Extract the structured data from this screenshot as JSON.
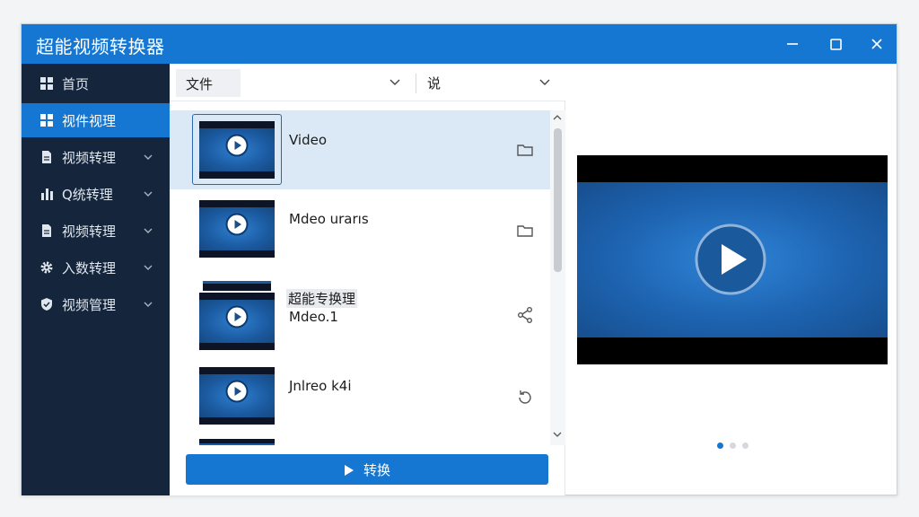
{
  "window": {
    "title": "超能视频转换器",
    "controls": [
      "minimize-icon",
      "maximize-icon",
      "close-icon"
    ]
  },
  "sidebar": {
    "items": [
      {
        "label": "首页",
        "icon": "grid-icon",
        "active": false,
        "expandable": false
      },
      {
        "label": "视件视理",
        "icon": "dashboard-icon",
        "active": true,
        "expandable": false
      },
      {
        "label": "视频转理",
        "icon": "document-icon",
        "active": false,
        "expandable": true
      },
      {
        "label": "Q统转理",
        "icon": "bar-chart-icon",
        "active": false,
        "expandable": true
      },
      {
        "label": "视频转理",
        "icon": "document-icon",
        "active": false,
        "expandable": true
      },
      {
        "label": "入数转理",
        "icon": "gear-icon",
        "active": false,
        "expandable": true
      },
      {
        "label": "视频管理",
        "icon": "shield-icon",
        "active": false,
        "expandable": true
      }
    ]
  },
  "toolbar": {
    "file_label": "文件",
    "sort_label": "说"
  },
  "files": [
    {
      "title": "Video",
      "subtitle": "",
      "action_icon": "folder-icon",
      "selected": true
    },
    {
      "title": "Mdeo urarıs",
      "subtitle": "",
      "action_icon": "folder-icon",
      "selected": false
    },
    {
      "title": "Mdeo.1",
      "subtitle": "超能专换理",
      "action_icon": "share-icon",
      "selected": false
    },
    {
      "title": "Jnlreo k4i",
      "subtitle": "",
      "action_icon": "refresh-icon",
      "selected": false
    }
  ],
  "convert_label": "转换",
  "preview": {
    "icon": "play-icon",
    "page_count": 3,
    "active_page": 1
  },
  "colors": {
    "accent": "#1677d2",
    "sidebar_bg": "#15253c",
    "selected_row": "#dbe9f7"
  }
}
